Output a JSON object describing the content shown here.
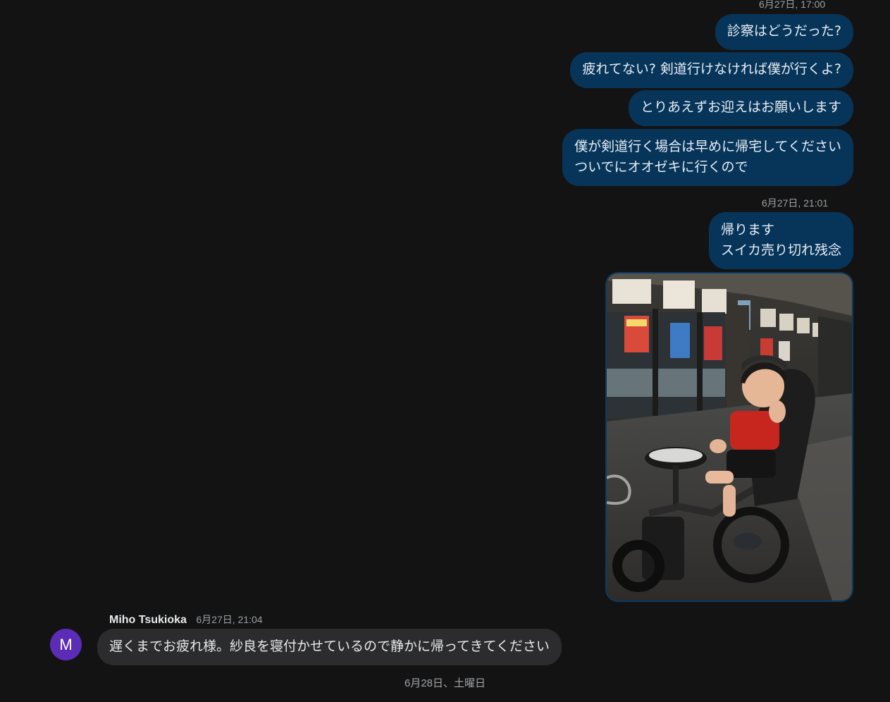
{
  "messages_out": [
    {
      "timestamp": "6月27日, 17:00",
      "bubbles": [
        "診察はどうだった?",
        "疲れてない? 剣道行けなければ僕が行くよ?",
        "とりあえずお迎えはお願いします"
      ],
      "multi": [
        "僕が剣道行く場合は早めに帰宅してください",
        "ついでにオオゼキに行くので"
      ]
    },
    {
      "timestamp": "6月27日, 21:01",
      "multi": [
        "帰ります",
        "スイカ売り切れ残念"
      ]
    }
  ],
  "incoming": {
    "avatar_letter": "M",
    "sender": "Miho Tsukioka",
    "timestamp": "6月27日, 21:04",
    "text": "遅くまでお疲れ様。紗良を寝付かせているので静かに帰ってきてください"
  },
  "date_divider": "6月28日、土曜日",
  "colors": {
    "background": "#131313",
    "outgoing_bubble": "#07355a",
    "incoming_bubble": "#2c2c2e",
    "avatar": "#5b2db7"
  }
}
